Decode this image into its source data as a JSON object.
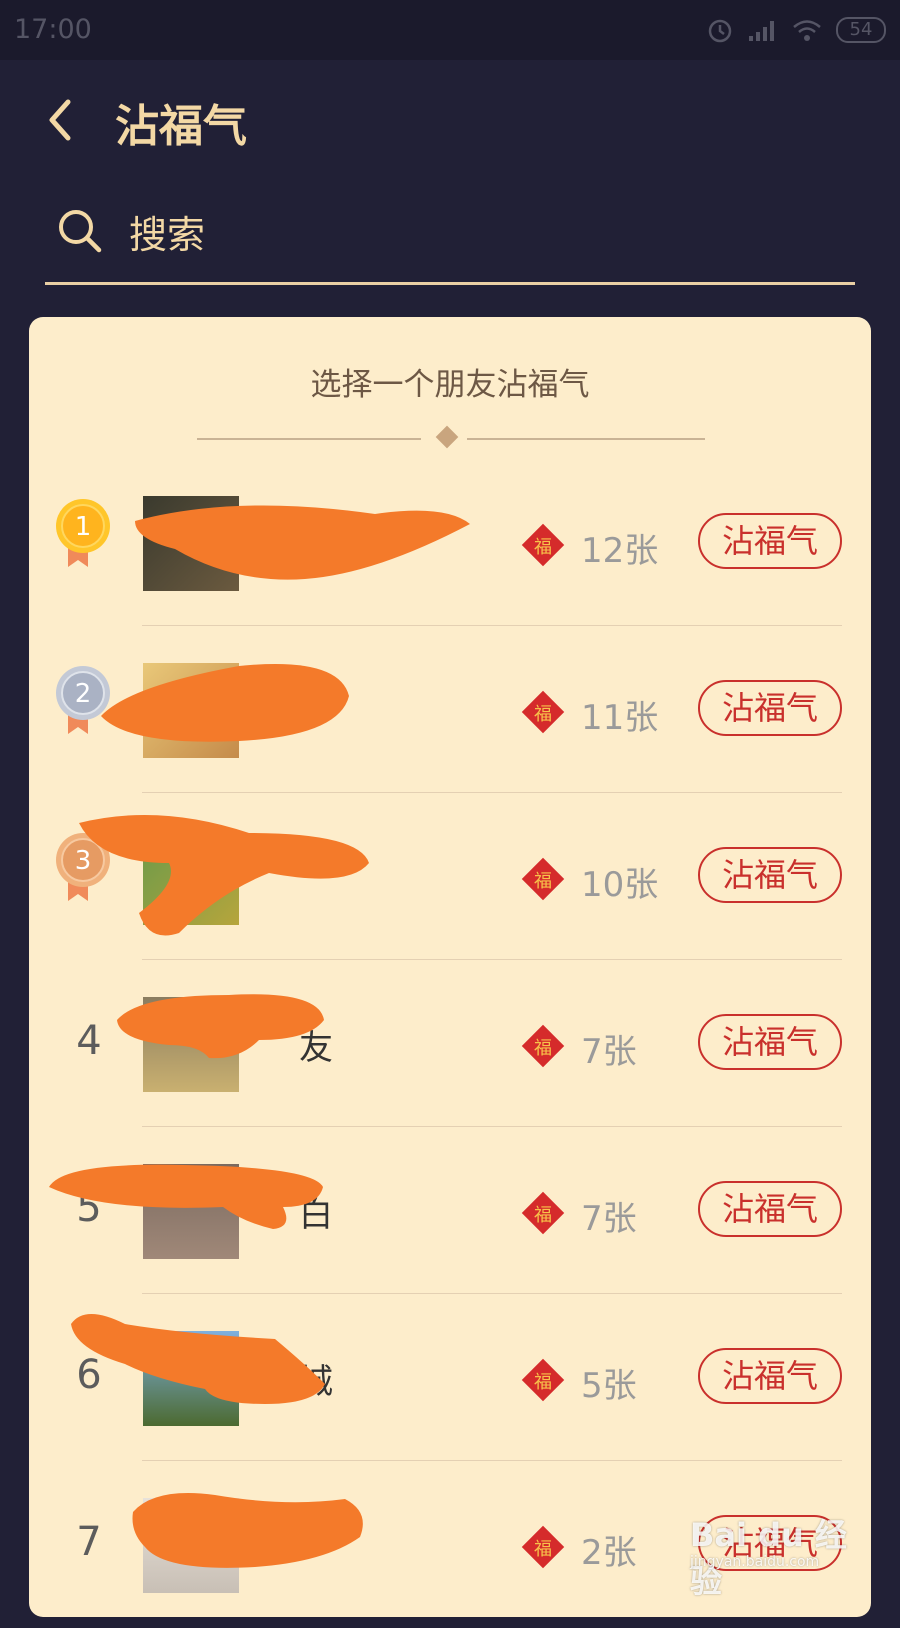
{
  "status_bar": {
    "time": "17:00",
    "battery": "54"
  },
  "header": {
    "title": "沾福气"
  },
  "search": {
    "placeholder": "搜索"
  },
  "card": {
    "title": "选择一个朋友沾福气",
    "friends": [
      {
        "rank": "1",
        "count": "12张",
        "button": "沾福气"
      },
      {
        "rank": "2",
        "count": "11张",
        "button": "沾福气"
      },
      {
        "rank": "3",
        "count": "10张",
        "button": "沾福气"
      },
      {
        "rank": "4",
        "name": "友",
        "count": "7张",
        "button": "沾福气"
      },
      {
        "rank": "5",
        "name": "白",
        "count": "7张",
        "button": "沾福气"
      },
      {
        "rank": "6",
        "name": "城",
        "count": "5张",
        "button": "沾福气"
      },
      {
        "rank": "7",
        "count": "2张",
        "button": "沾福气"
      }
    ],
    "fu_char": "福"
  },
  "watermark": {
    "brand": "Bai du 经验",
    "url": "jingyan.baidu.com"
  },
  "colors": {
    "background": "#212036",
    "gold_text": "#f3d8a5",
    "card_bg": "#fdedcb",
    "accent_red": "#c9302c",
    "scribble": "#f47a2a"
  }
}
